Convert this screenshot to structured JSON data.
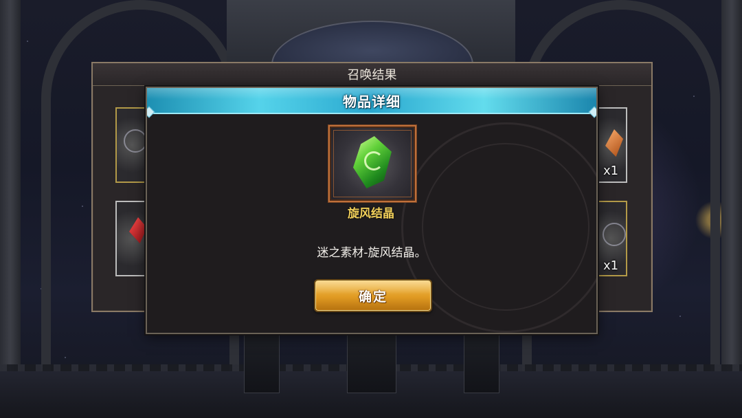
{
  "summon_panel": {
    "title": "召唤结果",
    "quantities": [
      "x1",
      "x1"
    ]
  },
  "item_dialog": {
    "title": "物品详细",
    "item": {
      "name": "旋风结晶",
      "icon": "green-wind-crystal-icon",
      "description": "迷之素材-旋风结晶。"
    },
    "confirm_label": "确定"
  },
  "colors": {
    "header_accent": "#4fc9e4",
    "item_name": "#f1cf5a",
    "button": "#e6a02a"
  }
}
